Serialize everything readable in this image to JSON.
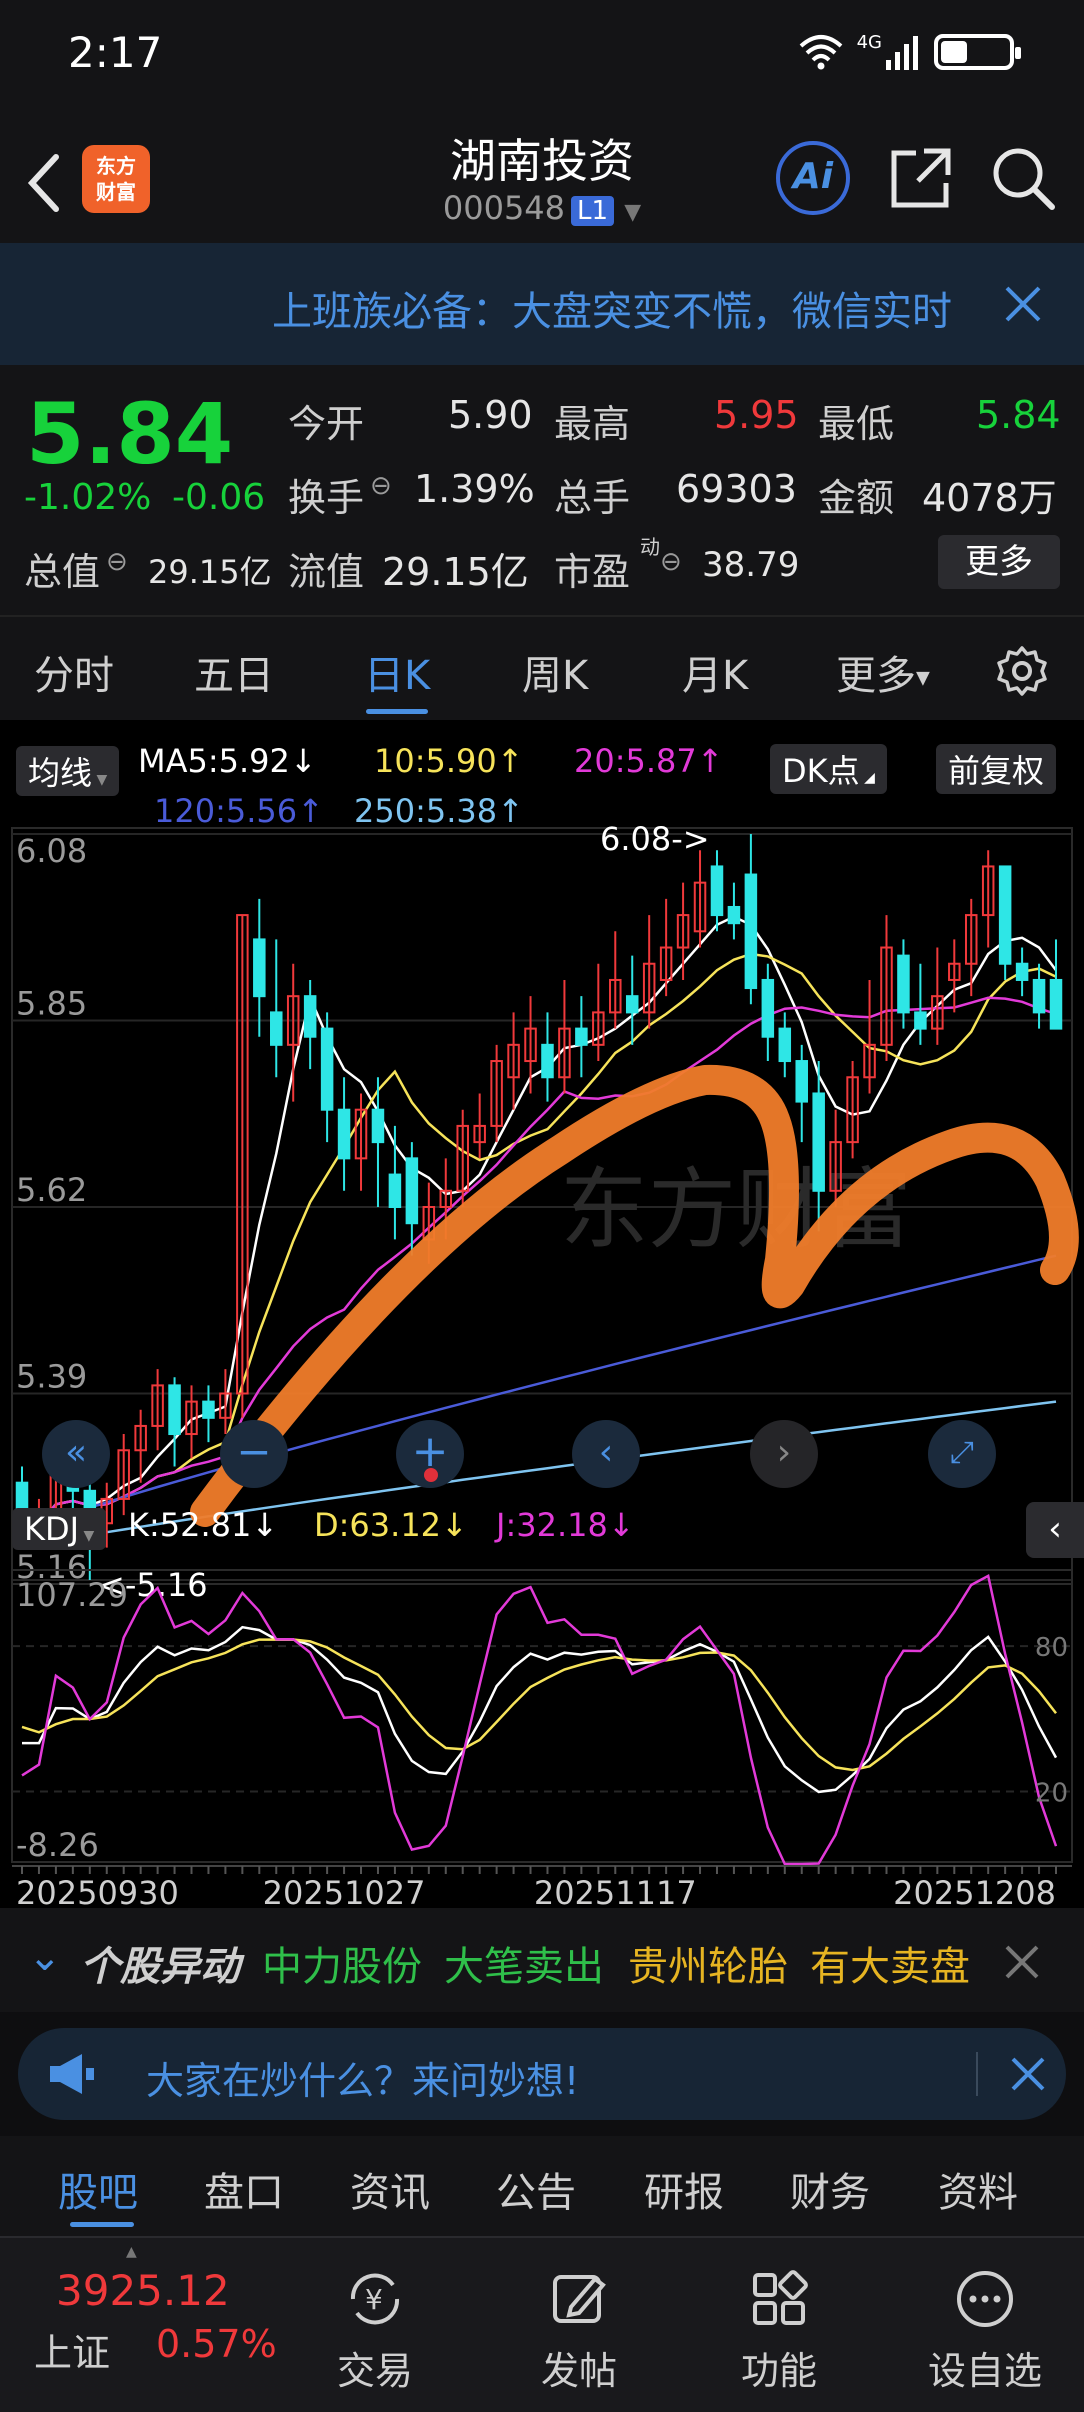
{
  "status_bar": {
    "time": "2:17",
    "network": "4G"
  },
  "header": {
    "logo_text": "东方\n财富",
    "stock_name": "湖南投资",
    "stock_code": "000548",
    "level_badge": "L1",
    "ai_label": "Ai"
  },
  "banner": {
    "text": "上班族必备：大盘突变不慌，微信实时"
  },
  "quote": {
    "price": "5.84",
    "change_pct": "-1.02%",
    "change": "-0.06",
    "fields": [
      {
        "label": "今开",
        "value": "5.90",
        "color": "#e6e6e6"
      },
      {
        "label": "最高",
        "value": "5.95",
        "color": "#f0393b"
      },
      {
        "label": "最低",
        "value": "5.84",
        "color": "#17d23b"
      },
      {
        "label": "换手",
        "value": "1.39%",
        "color": "#e6e6e6"
      },
      {
        "label": "总手",
        "value": "69303",
        "color": "#e6e6e6"
      },
      {
        "label": "金额",
        "value": "4078万",
        "color": "#e6e6e6"
      }
    ],
    "total_cap_label": "总值",
    "total_cap": "29.15亿",
    "float_cap_label": "流值",
    "float_cap": "29.15亿",
    "pe_label": "市盈",
    "pe_sup": "动",
    "pe": "38.79",
    "more": "更多"
  },
  "tabs": [
    "分时",
    "五日",
    "日K",
    "周K",
    "月K",
    "更多"
  ],
  "active_tab": 2,
  "ma_legend": {
    "button": "均线",
    "items": [
      {
        "text": "MA5:5.92↓",
        "color": "#ffffff"
      },
      {
        "text": "10:5.90↑",
        "color": "#f6e35a"
      },
      {
        "text": "20:5.87↑",
        "color": "#e23ad8"
      },
      {
        "text": "120:5.56↑",
        "color": "#4a5bd8"
      },
      {
        "text": "250:5.38↑",
        "color": "#7fc4f0"
      }
    ],
    "dk_button": "DK点",
    "adjust_button": "前复权"
  },
  "kdj_legend": {
    "button": "KDJ",
    "items": [
      {
        "text": "K:52.81↓",
        "color": "#ffffff"
      },
      {
        "text": "D:63.12↓",
        "color": "#f6e35a"
      },
      {
        "text": "J:32.18↓",
        "color": "#e23ad8"
      }
    ]
  },
  "chart_data": {
    "type": "candlestick",
    "price_axis_ticks": [
      "6.08",
      "5.85",
      "5.62",
      "5.39",
      "5.16"
    ],
    "price_range": [
      5.16,
      6.08
    ],
    "high_label": "6.08->",
    "low_label": "<-5.16",
    "watermark": "东方财富",
    "kdj_axis_ticks": [
      "107.29",
      "-8.26"
    ],
    "kdj_range": [
      -8.26,
      107.29
    ],
    "kdj_right_ticks": [
      "80",
      "20"
    ],
    "date_ticks": [
      "20250930",
      "20251027",
      "20251117",
      "20251208"
    ],
    "candles": [
      [
        5.28,
        5.22,
        5.3,
        5.2
      ],
      [
        5.22,
        5.24,
        5.26,
        5.2
      ],
      [
        5.24,
        5.3,
        5.32,
        5.22
      ],
      [
        5.3,
        5.27,
        5.33,
        5.24
      ],
      [
        5.27,
        5.23,
        5.3,
        5.16
      ],
      [
        5.23,
        5.26,
        5.28,
        5.2
      ],
      [
        5.26,
        5.32,
        5.34,
        5.24
      ],
      [
        5.32,
        5.35,
        5.37,
        5.28
      ],
      [
        5.35,
        5.4,
        5.42,
        5.32
      ],
      [
        5.4,
        5.34,
        5.41,
        5.3
      ],
      [
        5.34,
        5.38,
        5.4,
        5.31
      ],
      [
        5.38,
        5.36,
        5.4,
        5.33
      ],
      [
        5.36,
        5.39,
        5.42,
        5.34
      ],
      [
        5.39,
        5.98,
        5.98,
        5.36
      ],
      [
        5.95,
        5.88,
        6.0,
        5.83
      ],
      [
        5.86,
        5.82,
        5.95,
        5.78
      ],
      [
        5.82,
        5.88,
        5.92,
        5.75
      ],
      [
        5.88,
        5.83,
        5.9,
        5.79
      ],
      [
        5.84,
        5.74,
        5.86,
        5.7
      ],
      [
        5.74,
        5.68,
        5.78,
        5.64
      ],
      [
        5.68,
        5.74,
        5.76,
        5.64
      ],
      [
        5.74,
        5.7,
        5.78,
        5.62
      ],
      [
        5.66,
        5.62,
        5.72,
        5.58
      ],
      [
        5.68,
        5.6,
        5.7,
        5.56
      ],
      [
        5.58,
        5.62,
        5.65,
        5.55
      ],
      [
        5.62,
        5.64,
        5.68,
        5.58
      ],
      [
        5.64,
        5.72,
        5.74,
        5.62
      ],
      [
        5.7,
        5.72,
        5.76,
        5.68
      ],
      [
        5.72,
        5.8,
        5.82,
        5.7
      ],
      [
        5.78,
        5.82,
        5.86,
        5.74
      ],
      [
        5.8,
        5.84,
        5.88,
        5.76
      ],
      [
        5.82,
        5.78,
        5.86,
        5.75
      ],
      [
        5.78,
        5.84,
        5.9,
        5.76
      ],
      [
        5.84,
        5.82,
        5.88,
        5.78
      ],
      [
        5.82,
        5.86,
        5.92,
        5.8
      ],
      [
        5.86,
        5.9,
        5.96,
        5.84
      ],
      [
        5.88,
        5.86,
        5.93,
        5.82
      ],
      [
        5.86,
        5.92,
        5.98,
        5.84
      ],
      [
        5.9,
        5.94,
        6.0,
        5.88
      ],
      [
        5.94,
        5.98,
        6.02,
        5.9
      ],
      [
        5.96,
        6.02,
        6.06,
        5.94
      ],
      [
        6.04,
        5.98,
        6.06,
        5.96
      ],
      [
        5.99,
        5.97,
        6.02,
        5.95
      ],
      [
        6.03,
        5.89,
        6.08,
        5.87
      ],
      [
        5.9,
        5.83,
        5.92,
        5.8
      ],
      [
        5.84,
        5.8,
        5.86,
        5.78
      ],
      [
        5.8,
        5.75,
        5.82,
        5.7
      ],
      [
        5.76,
        5.64,
        5.8,
        5.59
      ],
      [
        5.64,
        5.7,
        5.74,
        5.62
      ],
      [
        5.7,
        5.78,
        5.8,
        5.68
      ],
      [
        5.78,
        5.82,
        5.9,
        5.76
      ],
      [
        5.82,
        5.94,
        5.98,
        5.8
      ],
      [
        5.93,
        5.86,
        5.95,
        5.84
      ],
      [
        5.86,
        5.84,
        5.92,
        5.82
      ],
      [
        5.84,
        5.88,
        5.94,
        5.82
      ],
      [
        5.9,
        5.92,
        5.95,
        5.86
      ],
      [
        5.92,
        5.98,
        6.0,
        5.88
      ],
      [
        5.98,
        6.04,
        6.06,
        5.94
      ],
      [
        6.04,
        5.92,
        6.03,
        5.9
      ],
      [
        5.92,
        5.9,
        5.94,
        5.88
      ],
      [
        5.9,
        5.86,
        5.92,
        5.84
      ],
      [
        5.9,
        5.84,
        5.95,
        5.84
      ]
    ]
  },
  "chart_toolbar": [
    "rewind-icon",
    "zoom-out-icon",
    "zoom-in-icon",
    "prev-icon",
    "next-icon",
    "fullscreen-icon"
  ],
  "alert": {
    "title": "个股异动",
    "items": [
      {
        "name": "中力股份",
        "action": "大笔卖出",
        "color": "#2fbf4a"
      },
      {
        "name": "贵州轮胎",
        "action": "有大卖盘",
        "color": "#e6b422"
      }
    ]
  },
  "ask": {
    "text": "大家在炒什么？来问妙想!"
  },
  "sub_tabs": [
    "股吧",
    "盘口",
    "资讯",
    "公告",
    "研报",
    "财务",
    "资料"
  ],
  "active_sub_tab": 0,
  "bottom_nav": {
    "index_value": "3925.12",
    "index_name": "上证",
    "index_change": "0.57%",
    "items": [
      "交易",
      "发帖",
      "功能",
      "设自选"
    ]
  }
}
